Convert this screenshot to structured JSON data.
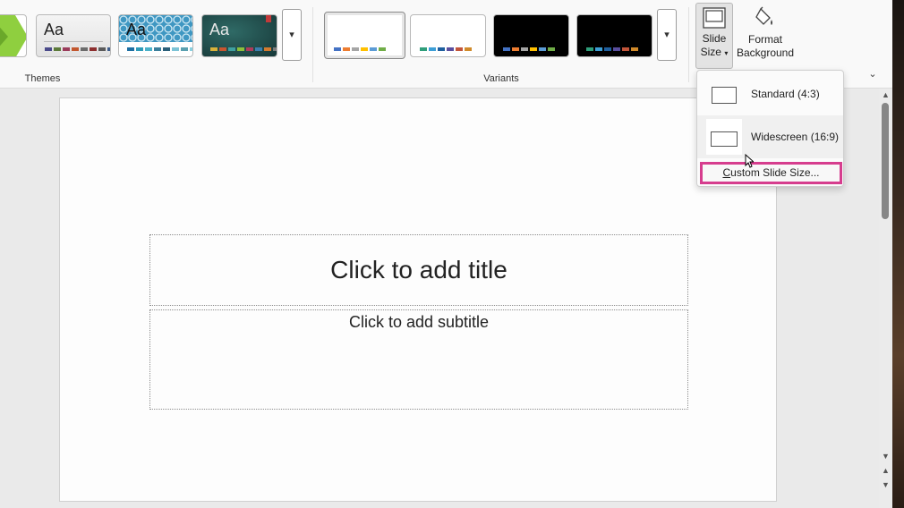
{
  "ribbon": {
    "themes_label": "Themes",
    "variants_label": "Variants",
    "themes": [
      {
        "name": "Facet",
        "aa": "",
        "bg": "#ffffff",
        "swatches": []
      },
      {
        "name": "Office Theme light",
        "aa": "Aa",
        "bg": "#efefef",
        "aa_color": "#222222",
        "swatches": [
          "#4a4a8a",
          "#5c7a3a",
          "#9a3b5a",
          "#c2572f",
          "#6b6b6b",
          "#8c2f2f",
          "#5a5a5a",
          "#3f5e8c"
        ]
      },
      {
        "name": "Patterned",
        "aa": "Aa",
        "bg": "#6fb6d6",
        "aa_color": "#111111",
        "swatches": [
          "#1d6fa3",
          "#2e9bb8",
          "#4bb1c9",
          "#3b7f9c",
          "#2a5f7a",
          "#7cc3d6",
          "#5aa0b0",
          "#88d0e0"
        ]
      },
      {
        "name": "Dark teal",
        "aa": "Aa",
        "bg": "#1f4a4a",
        "aa_color": "#e8e8e8",
        "swatches": [
          "#d9b23a",
          "#c8552f",
          "#3ea0a0",
          "#8cbf3a",
          "#b03a5a",
          "#3a7fb0",
          "#d47a2f",
          "#7a7a7a"
        ]
      }
    ],
    "variants": [
      {
        "bg": "#ffffff",
        "selected": true,
        "swatches": [
          "#4472c4",
          "#ed7d31",
          "#a5a5a5",
          "#ffc000",
          "#5b9bd5",
          "#70ad47"
        ]
      },
      {
        "bg": "#ffffff",
        "selected": false,
        "swatches": [
          "#2f9e7a",
          "#3c9ed6",
          "#1f5f9e",
          "#5a4e9e",
          "#c2553a",
          "#d08a2a"
        ]
      },
      {
        "bg": "#000000",
        "selected": false,
        "swatches": [
          "#4472c4",
          "#ed7d31",
          "#a5a5a5",
          "#ffc000",
          "#5b9bd5",
          "#70ad47"
        ]
      },
      {
        "bg": "#000000",
        "selected": false,
        "swatches": [
          "#2f9e7a",
          "#3c9ed6",
          "#1f5f9e",
          "#5a4e9e",
          "#c2553a",
          "#d08a2a"
        ]
      }
    ],
    "slide_size_line1": "Slide",
    "slide_size_line2": "Size",
    "format_background_line1": "Format",
    "format_background_line2": "Background"
  },
  "dropdown": {
    "standard_label": "Standard (4:3)",
    "widescreen_label": "Widescreen (16:9)",
    "custom_prefix": "",
    "custom_accel": "C",
    "custom_rest": "ustom Slide Size...",
    "highlight_color": "#d63d8e"
  },
  "slide": {
    "title_placeholder": "Click to add title",
    "subtitle_placeholder": "Click to add subtitle"
  }
}
